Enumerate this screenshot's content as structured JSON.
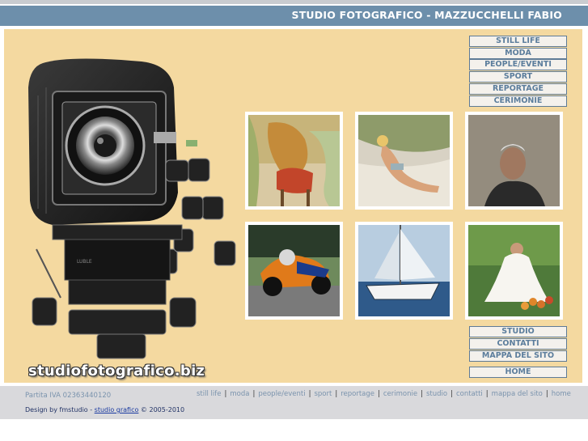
{
  "header": {
    "title": "STUDIO FOTOGRAFICO - MAZZUCCHELLI FABIO"
  },
  "logo": {
    "text": "studiofotografico.biz"
  },
  "nav_top": [
    {
      "label": "STILL LIFE"
    },
    {
      "label": "MODA"
    },
    {
      "label": "PEOPLE/EVENTI"
    },
    {
      "label": "SPORT"
    },
    {
      "label": "REPORTAGE"
    },
    {
      "label": "CERIMONIE"
    }
  ],
  "nav_bottom": [
    {
      "label": "STUDIO"
    },
    {
      "label": "CONTATTI"
    },
    {
      "label": "MAPPA DEL SITO"
    }
  ],
  "home": {
    "label": "HOME"
  },
  "thumbnails": [
    {
      "subject": "still-life"
    },
    {
      "subject": "moda"
    },
    {
      "subject": "people"
    },
    {
      "subject": "sport"
    },
    {
      "subject": "reportage"
    },
    {
      "subject": "cerimonie"
    }
  ],
  "footer": {
    "partita_iva": "Partita IVA 02363440120",
    "links": [
      "still life",
      "moda",
      "people/eventi",
      "sport",
      "reportage",
      "cerimonie",
      "studio",
      "contatti",
      "mappa del sito",
      "home"
    ],
    "design_prefix": "Design by fmstudio - ",
    "design_link": "studio grafico",
    "design_suffix": " © 2005-2010"
  },
  "colors": {
    "header_bg": "#6d8fab",
    "panel_bg": "#f4d9a0",
    "footer_bg": "#d9d9dc",
    "nav_text": "#5b7d9c"
  }
}
